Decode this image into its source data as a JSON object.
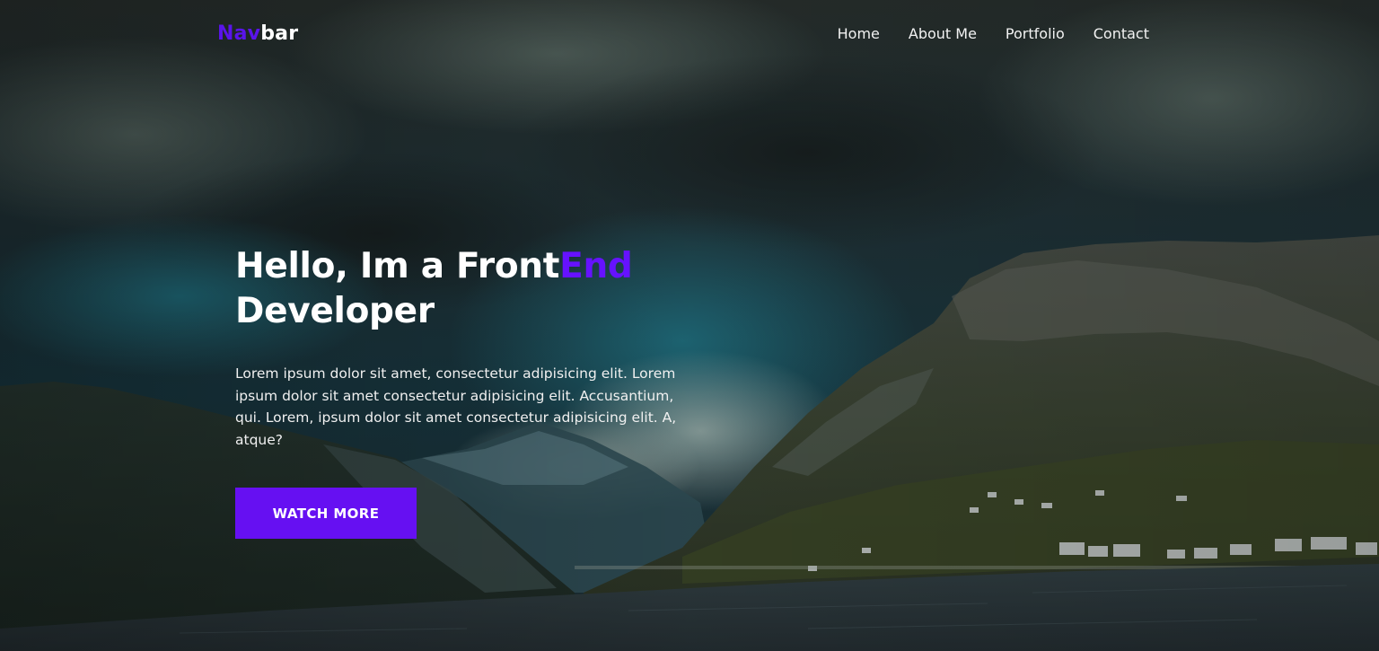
{
  "navbar": {
    "logo_accent": "Nav",
    "logo_rest": "bar",
    "links": [
      "Home",
      "About Me",
      "Portfolio",
      "Contact"
    ]
  },
  "hero": {
    "title_part1": "Hello, Im a Front",
    "title_accent": "End",
    "title_part2": "Developer",
    "description": "Lorem ipsum dolor sit amet, consectetur adipisicing elit. Lorem ipsum dolor sit amet consectetur adipisicing elit. Accusantium, qui. Lorem, ipsum dolor sit amet consectetur adipisicing elit. A, atque?",
    "button_label": "WATCH MORE"
  },
  "colors": {
    "accent": "#6610f2",
    "logo_accent": "#5a14ea",
    "text": "#ffffff"
  }
}
